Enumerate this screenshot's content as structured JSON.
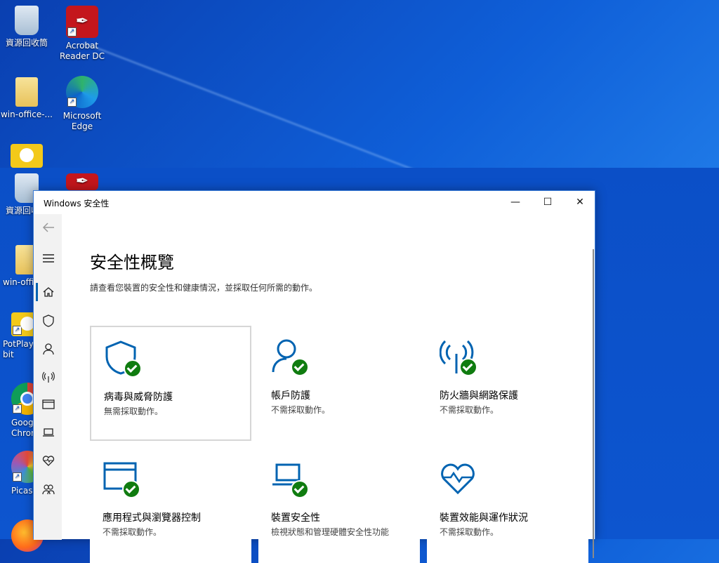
{
  "desktop": {
    "icons": [
      {
        "label": "資源回收筒"
      },
      {
        "label": "Acrobat Reader DC"
      },
      {
        "label": "win-office-..."
      },
      {
        "label": "Microsoft Edge"
      },
      {
        "label": "資源回收筒"
      },
      {
        "label": "win-offi"
      },
      {
        "label": "PotPlay bit"
      },
      {
        "label": "Goog Chror"
      },
      {
        "label": "Picasa"
      }
    ]
  },
  "window": {
    "title": "Windows 安全性",
    "minimize": "—",
    "maximize": "☐",
    "close": "✕"
  },
  "page": {
    "heading": "安全性概覽",
    "subtitle": "請查看您裝置的安全性和健康情況，並採取任何所需的動作。"
  },
  "cards": [
    {
      "title": "病毒與威脅防護",
      "status": "無需採取動作。",
      "icon": "virus-shield-icon"
    },
    {
      "title": "帳戶防護",
      "status": "不需採取動作。",
      "icon": "account-icon"
    },
    {
      "title": "防火牆與網路保護",
      "status": "不需採取動作。",
      "icon": "firewall-icon"
    },
    {
      "title": "應用程式與瀏覽器控制",
      "status": "不需採取動作。",
      "icon": "app-browser-icon"
    },
    {
      "title": "裝置安全性",
      "status": "檢視狀態和管理硬體安全性功能",
      "icon": "device-security-icon"
    },
    {
      "title": "裝置效能與運作狀況",
      "status": "不需採取動作。",
      "icon": "device-health-icon"
    }
  ],
  "colors": {
    "accent": "#0063b1",
    "ok": "#107c10"
  }
}
